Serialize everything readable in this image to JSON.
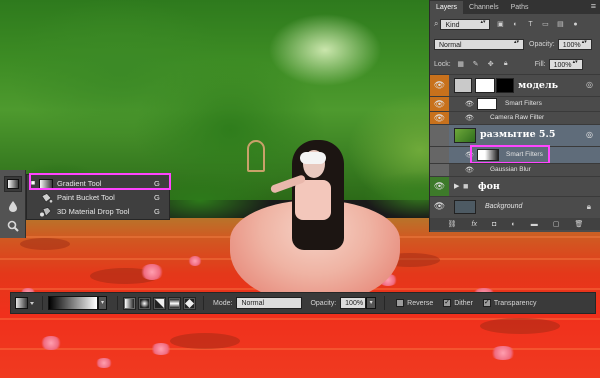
{
  "tool_flyout": {
    "items": [
      {
        "label": "Gradient Tool",
        "shortcut": "G",
        "active": true
      },
      {
        "label": "Paint Bucket Tool",
        "shortcut": "G",
        "active": false
      },
      {
        "label": "3D Material Drop Tool",
        "shortcut": "G",
        "active": false
      }
    ]
  },
  "layers_panel": {
    "tabs": [
      "Layers",
      "Channels",
      "Paths"
    ],
    "filter_kind": "Kind",
    "blend_mode": "Normal",
    "opacity_label": "Opacity:",
    "opacity_value": "100%",
    "lock_label": "Lock:",
    "fill_label": "Fill:",
    "fill_value": "100%",
    "layers": [
      {
        "name": "модель",
        "type": "smart-object"
      },
      {
        "name": "Smart Filters",
        "type": "smart-filters"
      },
      {
        "name": "Camera Raw Filter",
        "type": "filter"
      },
      {
        "name": "размытие 5.5",
        "type": "smart-object"
      },
      {
        "name": "Smart Filters",
        "type": "smart-filters"
      },
      {
        "name": "Gaussian Blur",
        "type": "filter"
      },
      {
        "name": "фон",
        "type": "group"
      },
      {
        "name": "Background",
        "type": "background"
      }
    ]
  },
  "options_bar": {
    "mode_label": "Mode:",
    "mode_value": "Normal",
    "opacity_label": "Opacity:",
    "opacity_value": "100%",
    "reverse_label": "Reverse",
    "reverse_checked": false,
    "dither_label": "Dither",
    "dither_checked": true,
    "transparency_label": "Transparency",
    "transparency_checked": true
  },
  "colors": {
    "highlight": "#ff45ff",
    "panel_bg": "#4b4b4b",
    "orange_label": "#c8711c",
    "green_label": "#3d7a2a"
  }
}
